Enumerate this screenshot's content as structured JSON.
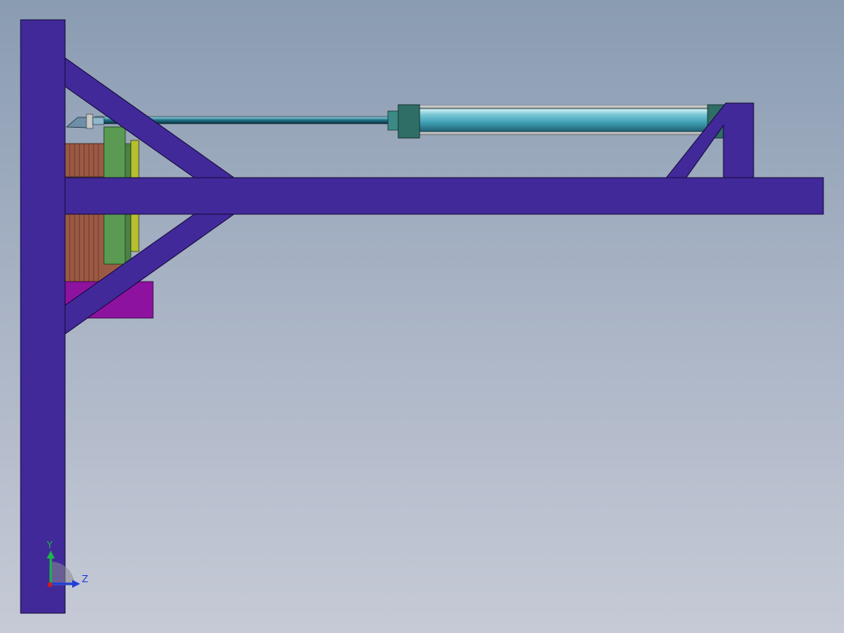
{
  "view": {
    "background_top": "#8a9cb2",
    "background_bottom": "#c6cad6"
  },
  "model": {
    "frame_color": "#42299a",
    "frame_edge_color": "#140a3a",
    "cylinder_color": "#4fb3c8",
    "cylinder_end_cap_color": "#2f6e66",
    "rod_color": "#1f6f86",
    "block_brown_color": "#9b5a44",
    "block_green_color": "#5a9a52",
    "block_yellow_color": "#b6c02e",
    "block_magenta_color": "#8e12a0"
  },
  "triad": {
    "y_label": "Y",
    "z_label": "Z",
    "y_color": "#1bb54a",
    "z_color": "#1f3fd8",
    "x_color": "#d21c1c"
  }
}
